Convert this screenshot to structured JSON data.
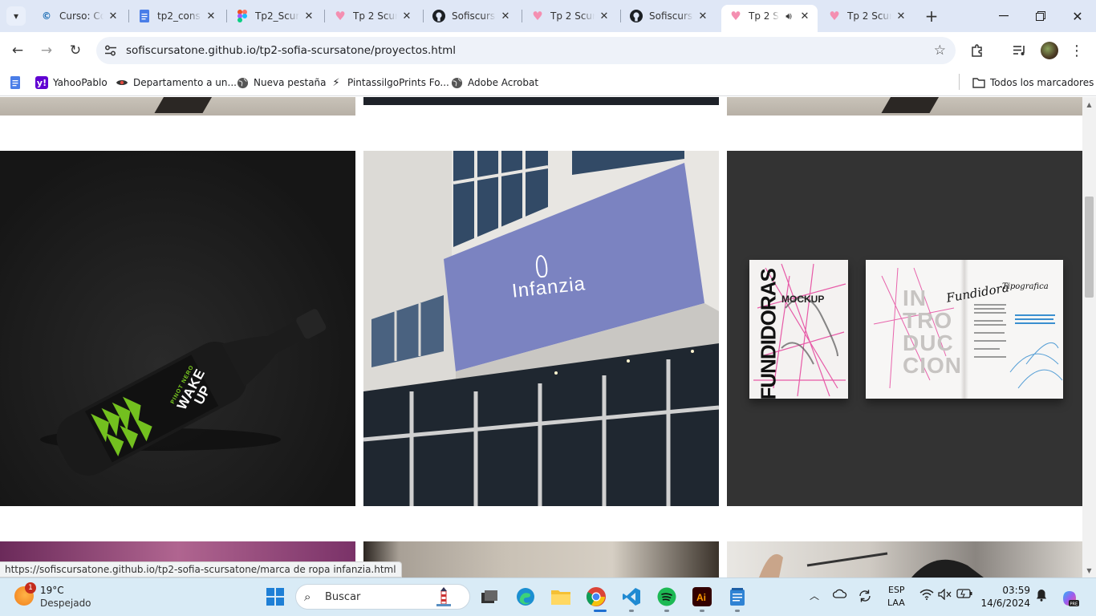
{
  "browser": {
    "tabs": [
      {
        "title": "Curso: Co",
        "icon": "moodle-icon",
        "active": false
      },
      {
        "title": "tp2_consi",
        "icon": "google-docs-icon",
        "active": false
      },
      {
        "title": "Tp2_Scurs",
        "icon": "figma-icon",
        "active": false
      },
      {
        "title": "Tp 2 Scurs",
        "icon": "heart-icon",
        "active": false
      },
      {
        "title": "Sofiscursa",
        "icon": "github-icon",
        "active": false
      },
      {
        "title": "Tp 2 Scurs",
        "icon": "heart-icon",
        "active": false
      },
      {
        "title": "Sofiscursa",
        "icon": "github-icon",
        "active": false
      },
      {
        "title": "Tp 2 S",
        "icon": "heart-icon",
        "active": true,
        "audio": true
      },
      {
        "title": "Tp 2 Scurs",
        "icon": "heart-icon",
        "active": false
      }
    ],
    "url": "sofiscursatone.github.io/tp2-sofia-scursatone/proyectos.html",
    "bookmarks": [
      {
        "label": "YahooPablo",
        "icon": "yahoo-icon"
      },
      {
        "label": "Departamento a un...",
        "icon": "eye-icon"
      },
      {
        "label": "Nueva pestaña",
        "icon": "globe-icon"
      },
      {
        "label": "PintassilgoPrints Fo...",
        "icon": "bolt-icon"
      },
      {
        "label": "Adobe Acrobat",
        "icon": "globe-icon"
      }
    ],
    "all_bookmarks_label": "Todos los marcadores",
    "status_url": "https://sofiscursatone.github.io/tp2-sofia-scursatone/marca de ropa infanzia.html"
  },
  "projects": {
    "row2": [
      {
        "name": "wine-bottle-mockup",
        "label_lines": [
          "WAKE",
          "UP"
        ],
        "sub": "PINOT NERO"
      },
      {
        "name": "infanzia-signage",
        "brand": "Infanzia"
      },
      {
        "name": "fundidoras-magazine",
        "cover_title": "FUNDIDORAS",
        "cover_sub": "MOCKUP",
        "spread_title": [
          "IN",
          "TRO",
          "DUC",
          "CION"
        ],
        "script": "Fundidora",
        "script2": "Tipografica"
      }
    ]
  },
  "taskbar": {
    "weather": {
      "temp": "19°C",
      "condition": "Despejado",
      "badge": "1"
    },
    "search_placeholder": "Buscar",
    "lang_top": "ESP",
    "lang_bottom": "LAA",
    "time": "03:59",
    "date": "14/6/2024"
  },
  "colors": {
    "tabstrip": "#dfe7f6",
    "signage": "#7b83c1",
    "magazine_bg": "#333333",
    "bottle_bg": "#1d1d1d",
    "accent_green": "#7ed321"
  }
}
